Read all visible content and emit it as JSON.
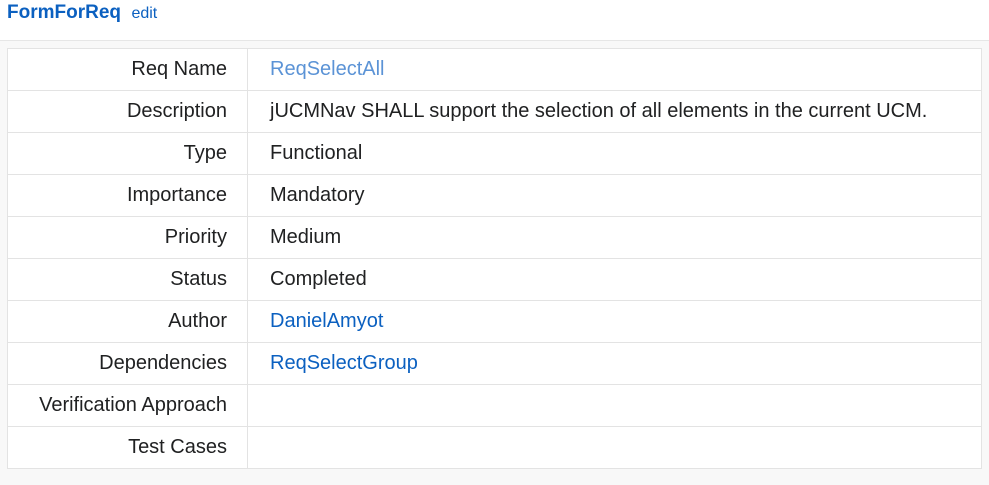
{
  "header": {
    "title": "FormForReq",
    "edit_label": "edit"
  },
  "rows": {
    "req_name": {
      "label": "Req Name",
      "value": "ReqSelectAll"
    },
    "description": {
      "label": "Description",
      "value": "jUCMNav SHALL support the selection of all elements in the current UCM."
    },
    "type": {
      "label": "Type",
      "value": "Functional"
    },
    "importance": {
      "label": "Importance",
      "value": "Mandatory"
    },
    "priority": {
      "label": "Priority",
      "value": "Medium"
    },
    "status": {
      "label": "Status",
      "value": "Completed"
    },
    "author": {
      "label": "Author",
      "value": "DanielAmyot"
    },
    "dependencies": {
      "label": "Dependencies",
      "value": "ReqSelectGroup"
    },
    "verification_approach": {
      "label": "Verification Approach",
      "value": ""
    },
    "test_cases": {
      "label": "Test Cases",
      "value": ""
    }
  },
  "colors": {
    "link": "#0b60c0",
    "self_link": "#5b93d6",
    "text": "#202122",
    "panel_bg": "#f8f8f8",
    "border": "#e3e3e3"
  }
}
